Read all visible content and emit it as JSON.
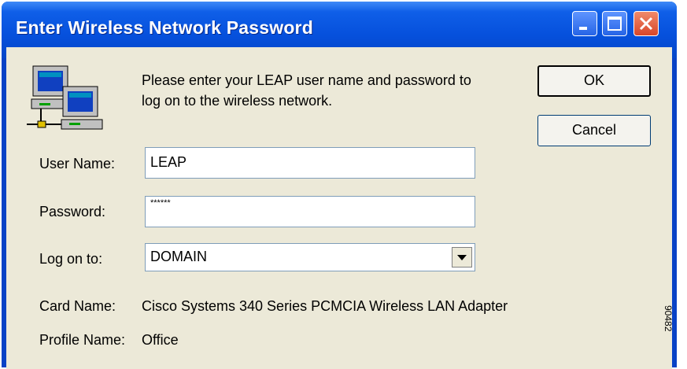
{
  "window": {
    "title": "Enter Wireless Network Password"
  },
  "title_buttons": {
    "minimize": "minimize-icon",
    "maximize": "maximize-icon",
    "close": "close-icon"
  },
  "message": {
    "line1": "Please enter your LEAP user name and password to",
    "line2": "log on to the wireless network."
  },
  "buttons": {
    "ok": "OK",
    "cancel": "Cancel"
  },
  "form": {
    "username_label": "User Name:",
    "username_value": "LEAP",
    "password_label": "Password:",
    "password_value": "******",
    "logon_label": "Log on to:",
    "logon_value": "DOMAIN"
  },
  "info": {
    "card_label": "Card Name:",
    "card_value": "Cisco Systems 340 Series PCMCIA Wireless LAN Adapter",
    "profile_label": "Profile Name:",
    "profile_value": "Office"
  },
  "side_code": "90482",
  "icons": {
    "network": "network-computers-icon",
    "dropdown": "chevron-down-icon"
  },
  "colors": {
    "titlebar": "#0650dc",
    "client": "#ece9d8",
    "close": "#d8462a"
  }
}
